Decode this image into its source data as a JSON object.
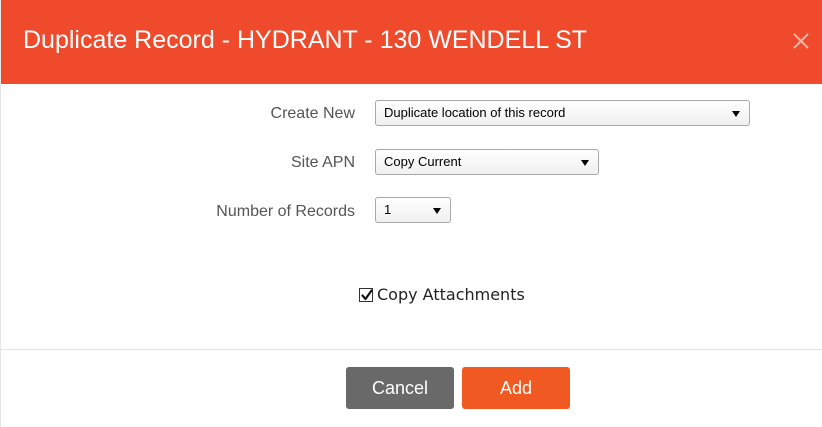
{
  "dialog": {
    "title": "Duplicate Record - HYDRANT - 130 WENDELL ST",
    "close_icon": "close-icon",
    "header_color": "#ee4a2b"
  },
  "form": {
    "create_new": {
      "label": "Create New",
      "selected": "Duplicate location of this record"
    },
    "site_apn": {
      "label": "Site APN",
      "selected": "Copy Current"
    },
    "number_of_records": {
      "label": "Number of Records",
      "selected": "1"
    },
    "copy_attachments": {
      "label": "Copy Attachments",
      "checked": true
    }
  },
  "footer": {
    "cancel_label": "Cancel",
    "add_label": "Add",
    "cancel_color": "#696969",
    "add_color": "#f05a22"
  }
}
